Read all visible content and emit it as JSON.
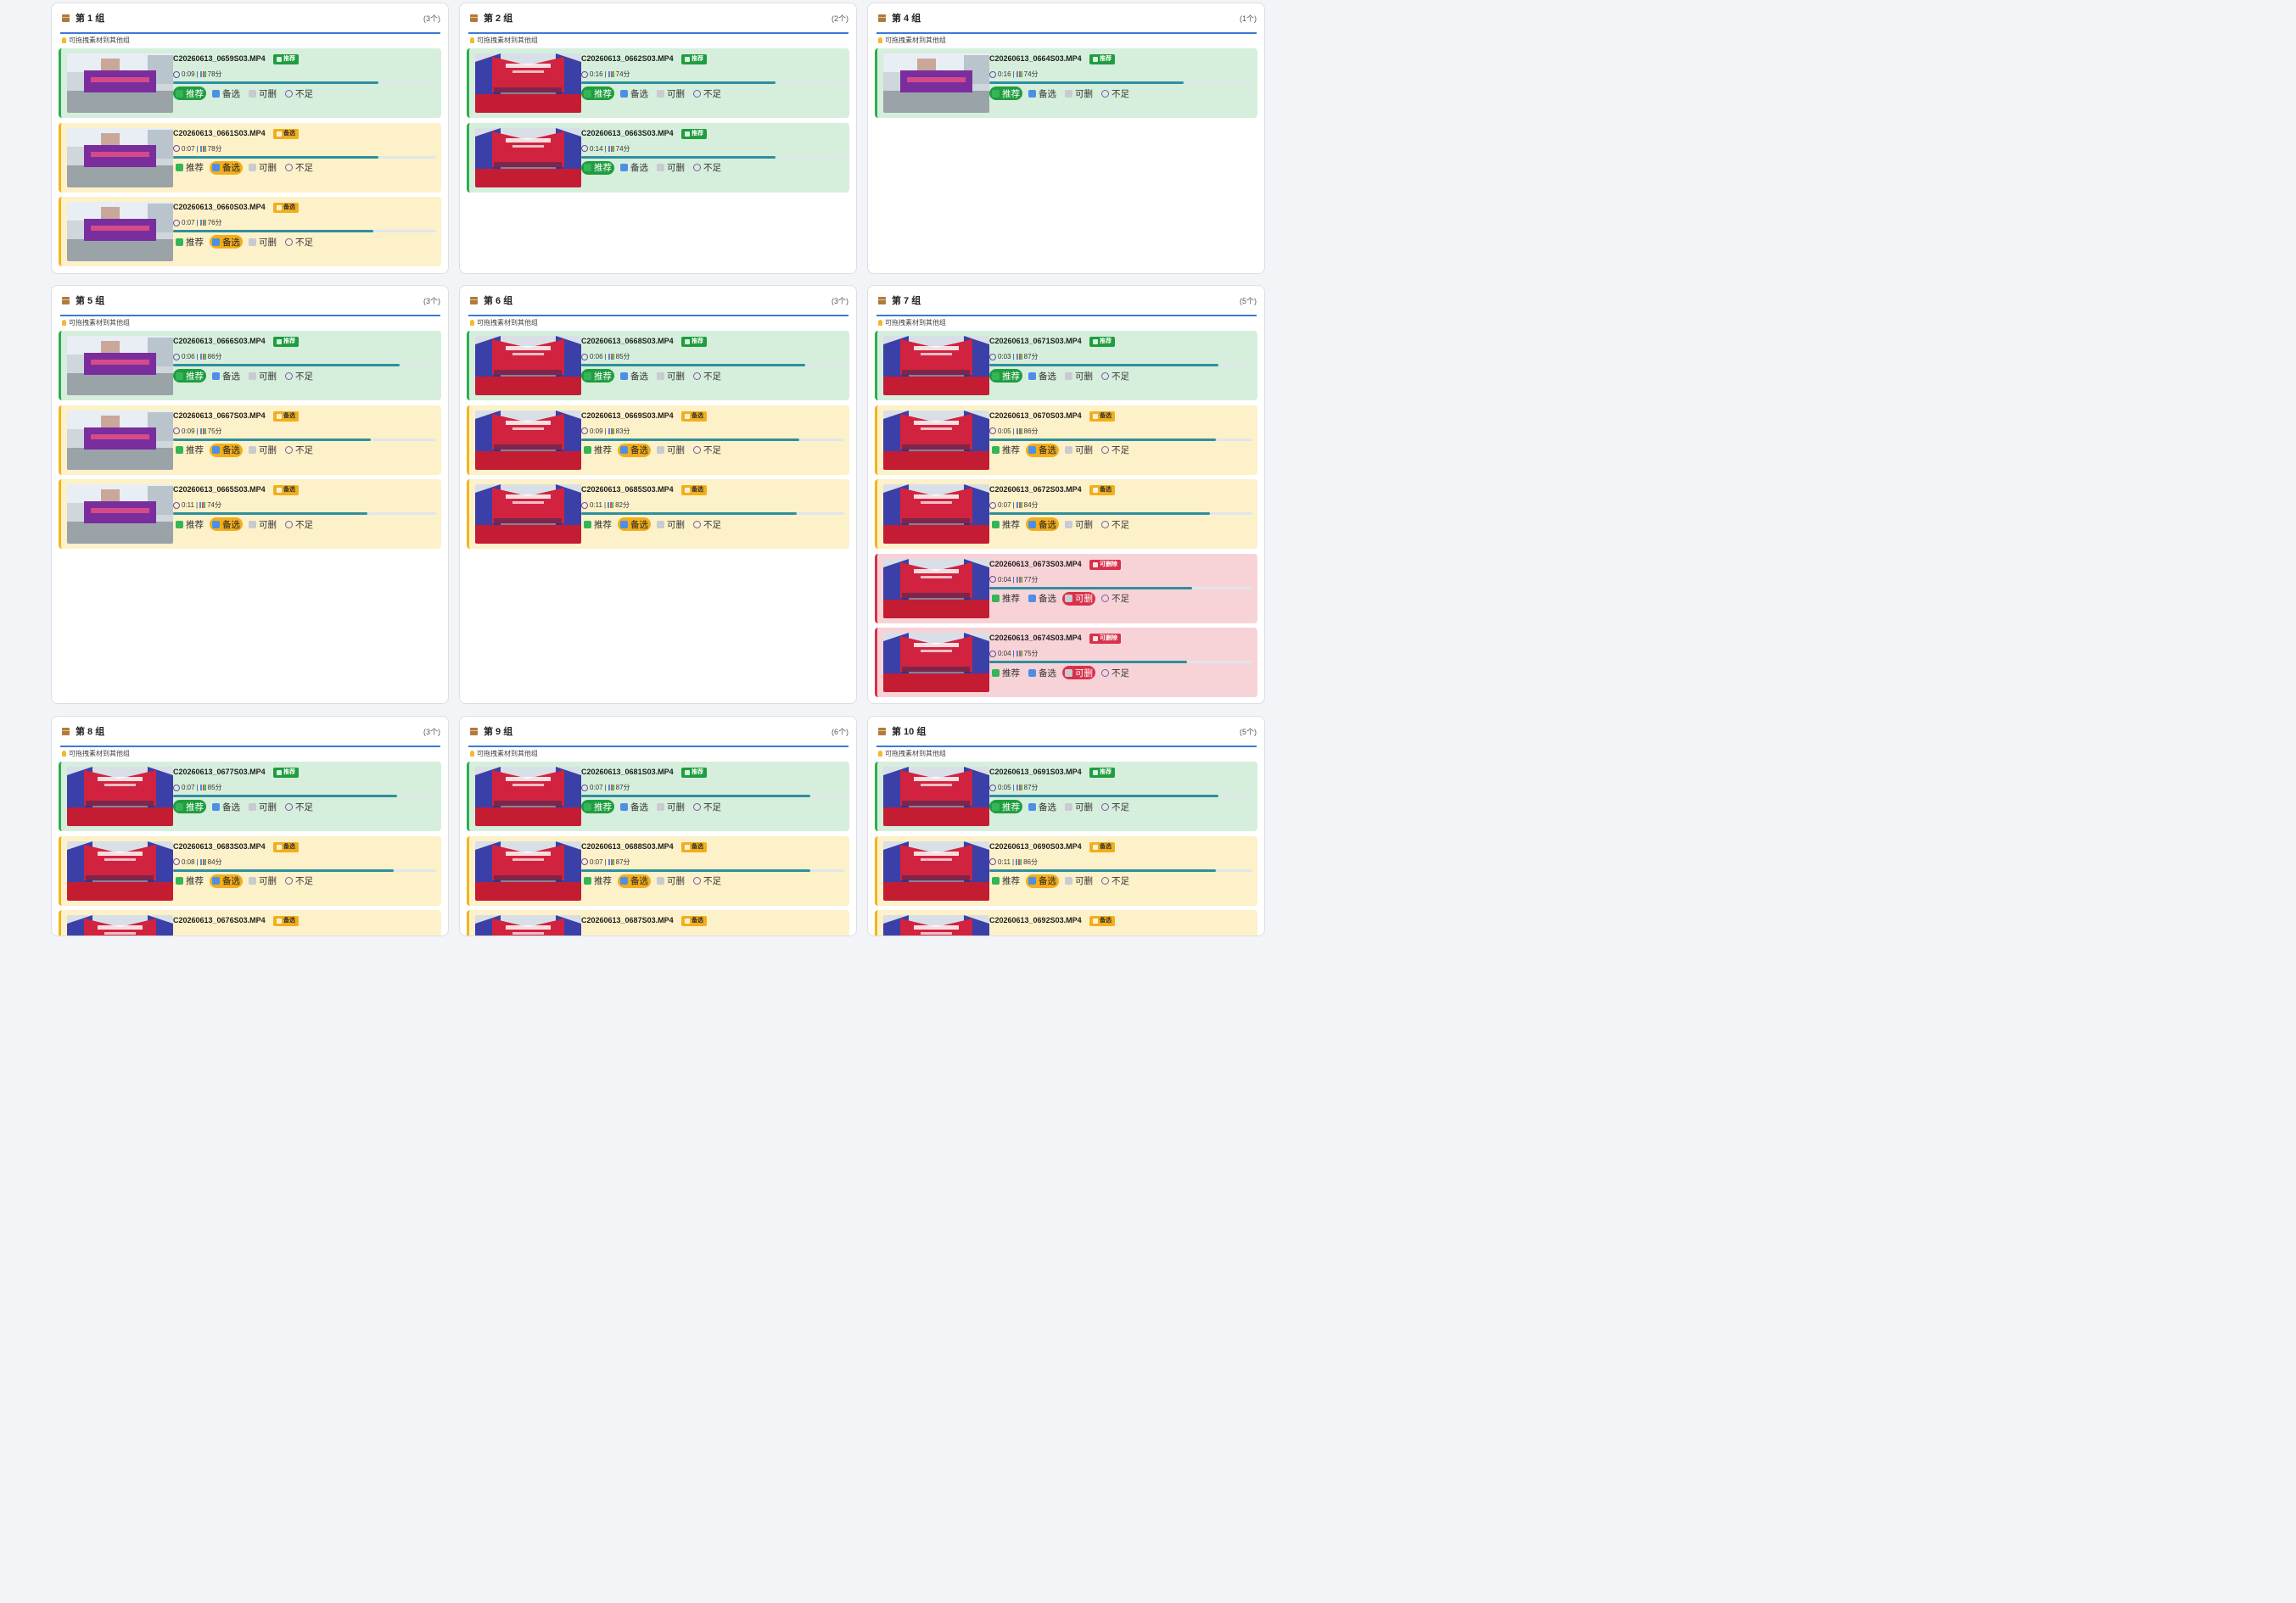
{
  "labels": {
    "hint": "可拖拽素材到其他组",
    "tag_rec": "推荐",
    "tag_alt": "备选",
    "tag_del": "可删除",
    "act_rec": "推荐",
    "act_alt": "备选",
    "act_del": "可删",
    "act_bad": "不足"
  },
  "colors": {
    "recommend": "#1f9d3f",
    "alternate": "#f2ae1c",
    "deletable": "#d8314a",
    "accent": "#3a7bd5"
  },
  "groups": [
    {
      "title": "第 1 组",
      "count": "(3个)",
      "items": [
        {
          "file": "C20260613_0659S03.MP4",
          "status": "rec",
          "duration": "0:09",
          "score": "78分",
          "progress": 0.78
        },
        {
          "file": "C20260613_0661S03.MP4",
          "status": "alt",
          "duration": "0:07",
          "score": "78分",
          "progress": 0.78
        },
        {
          "file": "C20260613_0660S03.MP4",
          "status": "alt",
          "duration": "0:07",
          "score": "76分",
          "progress": 0.76
        }
      ]
    },
    {
      "title": "第 2 组",
      "count": "(2个)",
      "items": [
        {
          "file": "C20260613_0662S03.MP4",
          "status": "rec",
          "duration": "0:16",
          "score": "74分",
          "progress": 0.74
        },
        {
          "file": "C20260613_0663S03.MP4",
          "status": "rec",
          "duration": "0:14",
          "score": "74分",
          "progress": 0.74
        }
      ]
    },
    {
      "title": "第 4 组",
      "count": "(1个)",
      "items": [
        {
          "file": "C20260613_0664S03.MP4",
          "status": "rec",
          "duration": "0:16",
          "score": "74分",
          "progress": 0.74
        }
      ]
    },
    {
      "title": "第 5 组",
      "count": "(3个)",
      "items": [
        {
          "file": "C20260613_0666S03.MP4",
          "status": "rec",
          "duration": "0:06",
          "score": "86分",
          "progress": 0.86
        },
        {
          "file": "C20260613_0667S03.MP4",
          "status": "alt",
          "duration": "0:09",
          "score": "75分",
          "progress": 0.75
        },
        {
          "file": "C20260613_0665S03.MP4",
          "status": "alt",
          "duration": "0:11",
          "score": "74分",
          "progress": 0.74
        }
      ]
    },
    {
      "title": "第 6 组",
      "count": "(3个)",
      "items": [
        {
          "file": "C20260613_0668S03.MP4",
          "status": "rec",
          "duration": "0:06",
          "score": "85分",
          "progress": 0.85
        },
        {
          "file": "C20260613_0669S03.MP4",
          "status": "alt",
          "duration": "0:09",
          "score": "83分",
          "progress": 0.83
        },
        {
          "file": "C20260613_0685S03.MP4",
          "status": "alt",
          "duration": "0:11",
          "score": "82分",
          "progress": 0.82
        }
      ]
    },
    {
      "title": "第 7 组",
      "count": "(5个)",
      "items": [
        {
          "file": "C20260613_0671S03.MP4",
          "status": "rec",
          "duration": "0:03",
          "score": "87分",
          "progress": 0.87
        },
        {
          "file": "C20260613_0670S03.MP4",
          "status": "alt",
          "duration": "0:05",
          "score": "86分",
          "progress": 0.86
        },
        {
          "file": "C20260613_0672S03.MP4",
          "status": "alt",
          "duration": "0:07",
          "score": "84分",
          "progress": 0.84
        },
        {
          "file": "C20260613_0673S03.MP4",
          "status": "del",
          "duration": "0:04",
          "score": "77分",
          "progress": 0.77
        },
        {
          "file": "C20260613_0674S03.MP4",
          "status": "del",
          "duration": "0:04",
          "score": "75分",
          "progress": 0.75
        }
      ]
    },
    {
      "title": "第 8 组",
      "count": "(3个)",
      "items": [
        {
          "file": "C20260613_0677S03.MP4",
          "status": "rec",
          "duration": "0:07",
          "score": "85分",
          "progress": 0.85
        },
        {
          "file": "C20260613_0683S03.MP4",
          "status": "alt",
          "duration": "0:08",
          "score": "84分",
          "progress": 0.84
        },
        {
          "file": "C20260613_0676S03.MP4",
          "status": "alt",
          "duration": "",
          "score": "",
          "progress": 0.8
        }
      ]
    },
    {
      "title": "第 9 组",
      "count": "(6个)",
      "items": [
        {
          "file": "C20260613_0681S03.MP4",
          "status": "rec",
          "duration": "0:07",
          "score": "87分",
          "progress": 0.87
        },
        {
          "file": "C20260613_0688S03.MP4",
          "status": "alt",
          "duration": "0:07",
          "score": "87分",
          "progress": 0.87
        },
        {
          "file": "C20260613_0687S03.MP4",
          "status": "alt",
          "duration": "",
          "score": "",
          "progress": 0.8
        }
      ]
    },
    {
      "title": "第 10 组",
      "count": "(5个)",
      "items": [
        {
          "file": "C20260613_0691S03.MP4",
          "status": "rec",
          "duration": "0:05",
          "score": "87分",
          "progress": 0.87
        },
        {
          "file": "C20260613_0690S03.MP4",
          "status": "alt",
          "duration": "0:11",
          "score": "86分",
          "progress": 0.86
        },
        {
          "file": "C20260613_0692S03.MP4",
          "status": "alt",
          "duration": "",
          "score": "",
          "progress": 0.8
        }
      ]
    }
  ]
}
